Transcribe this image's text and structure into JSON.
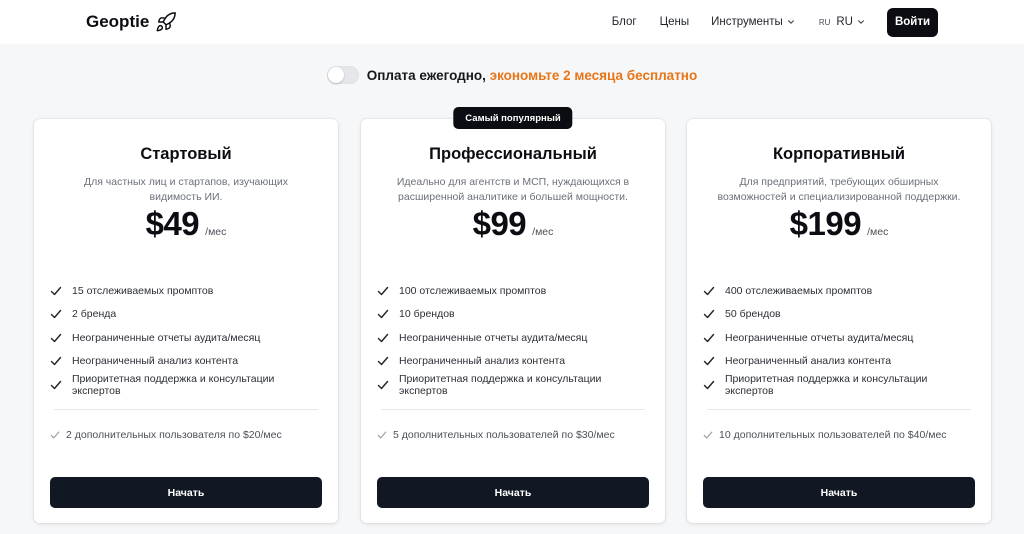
{
  "header": {
    "logo_text": "Geoptie",
    "nav": {
      "blog": "Блог",
      "prices": "Цены",
      "tools": "Инструменты",
      "lang_code": "RU",
      "lang_label": "RU"
    },
    "login_label": "Войти"
  },
  "billing": {
    "label": "Оплата ежегодно,",
    "promo": "экономьте 2 месяца бесплатно",
    "annual_enabled": false,
    "promo_color": "#e87517"
  },
  "plans": [
    {
      "name": "Стартовый",
      "description": "Для частных лиц и стартапов, изучающих видимость ИИ.",
      "price": "$49",
      "period": "/мес",
      "features": [
        "15 отслеживаемых промптов",
        "2 бренда",
        "Неограниченные отчеты аудита/месяц",
        "Неограниченный анализ контента",
        "Приоритетная поддержка и консультации экспертов"
      ],
      "extra": "2 дополнительных пользователя по $20/мес",
      "cta": "Начать"
    },
    {
      "badge": "Самый популярный",
      "name": "Профессиональный",
      "description": "Идеально для агентств и МСП, нуждающихся в расширенной аналитике и большей мощности.",
      "price": "$99",
      "period": "/мес",
      "features": [
        "100 отслеживаемых промптов",
        "10 брендов",
        "Неограниченные отчеты аудита/месяц",
        "Неограниченный анализ контента",
        "Приоритетная поддержка и консультации экспертов"
      ],
      "extra": "5 дополнительных пользователей по $30/мес",
      "cta": "Начать"
    },
    {
      "name": "Корпоративный",
      "description": "Для предприятий, требующих обширных возможностей и специализированной поддержки.",
      "price": "$199",
      "period": "/мес",
      "features": [
        "400 отслеживаемых промптов",
        "50 брендов",
        "Неограниченные отчеты аудита/месяц",
        "Неограниченный анализ контента",
        "Приоритетная поддержка и консультации экспертов"
      ],
      "extra": "10 дополнительных пользователей по $40/мес",
      "cta": "Начать"
    }
  ],
  "icons": {
    "logo": "rocket-icon",
    "feature": "check-icon",
    "nav_dropdown": "chevron-down-icon"
  },
  "colors": {
    "dark": "#0b0d12",
    "button": "#111723",
    "accent": "#e87517"
  }
}
